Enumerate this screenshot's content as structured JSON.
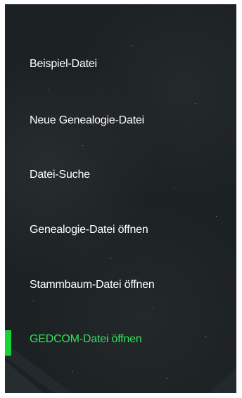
{
  "menu": {
    "items": [
      {
        "label": "Beispiel-Datei"
      },
      {
        "label": "Neue Genealogie-Datei"
      },
      {
        "label": "Datei-Suche"
      },
      {
        "label": "Genealogie-Datei öffnen"
      },
      {
        "label": "Stammbaum-Datei öffnen"
      },
      {
        "label": "GEDCOM-Datei öffnen"
      }
    ],
    "active_index": 5
  },
  "colors": {
    "background": "#1c2124",
    "text": "#ffffff",
    "active_text": "#33e05a",
    "accent": "#18d339"
  }
}
